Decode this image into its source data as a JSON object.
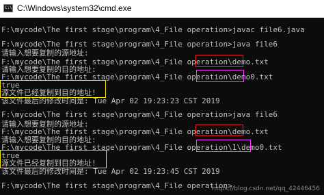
{
  "window": {
    "title": "C:\\Windows\\system32\\cmd.exe",
    "icon_name": "terminal-icon",
    "icon_glyph": "C:\\"
  },
  "console": {
    "lines": [
      "",
      "F:\\mycode\\The first stage\\program\\4_File operation>javac file6.java",
      "",
      "F:\\mycode\\The first stage\\program\\4_File operation>java file6",
      "请输入想要复制的源地址:",
      "F:\\mycode\\The first stage\\program\\4_File operation\\demo.txt",
      "请输入想要复制的目的地址:",
      "F:\\mycode\\The first stage\\program\\4_File operation\\demo0.txt",
      "true",
      "源文件已经复制到目的地址!",
      "该文件最后的修改时间是: Tue Apr 02 19:23:23 CST 2019",
      "",
      "F:\\mycode\\The first stage\\program\\4_File operation>java file6",
      "请输入想要复制的源地址:",
      "F:\\mycode\\The first stage\\program\\4_File operation\\demo.txt",
      "请输入想要复制的目的地址:",
      "F:\\mycode\\The first stage\\program\\4_File operation\\1\\demo0.txt",
      "true",
      "源文件已经复制到目的地址!",
      "该文件最后的修改时间是: Tue Apr 02 19:23:45 CST 2019",
      "",
      "F:\\mycode\\The first stage\\program\\4_File operation>"
    ],
    "highlight_colors": {
      "red": "#e8262d",
      "magenta": "#ff3dff",
      "yellow": "#f2e600"
    }
  },
  "watermark": "https://blog.csdn.net/qq_42446456"
}
